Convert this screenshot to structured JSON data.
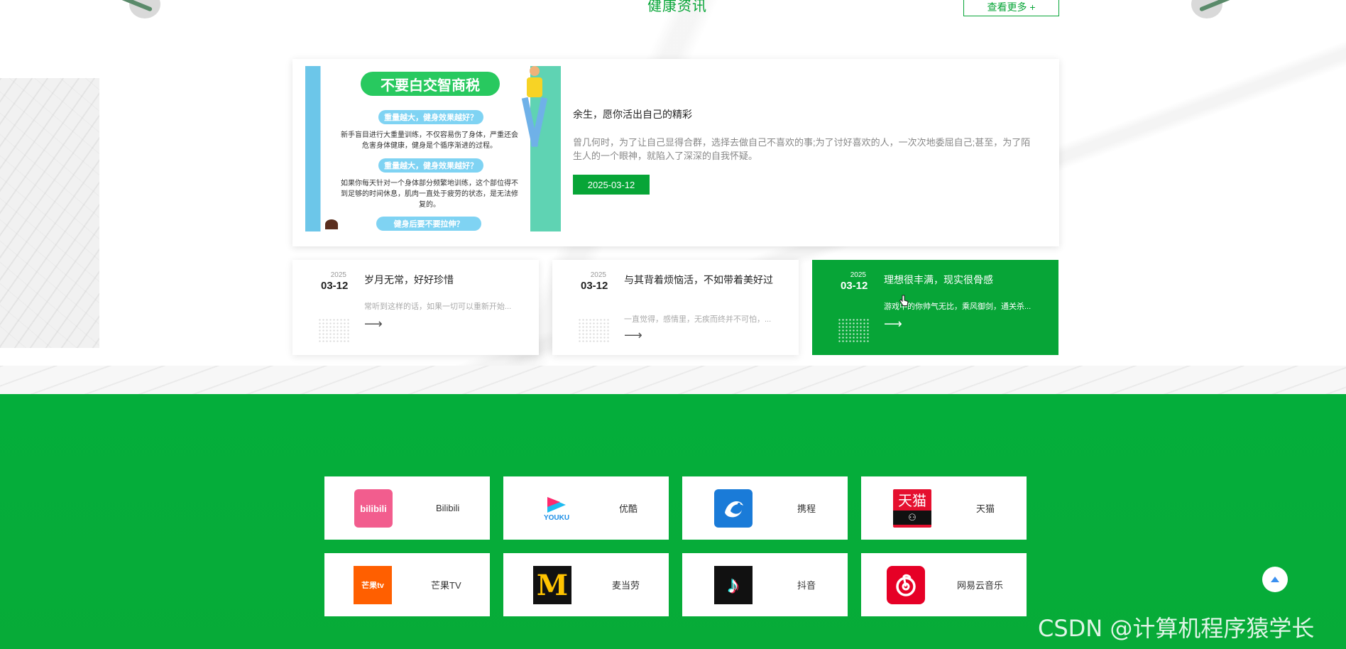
{
  "header": {
    "section_title": "健康资讯",
    "more_label": "查看更多 +"
  },
  "featured": {
    "poster": {
      "title": "不要白交智商税",
      "pill1": "重量越大，健身效果越好？",
      "text1": "新手盲目进行大重量训练，不仅容易伤了身体，严重还会危害身体健康，健身是个循序渐进的过程。",
      "pill2": "重量越大，健身效果越好？",
      "text2": "如果你每天针对一个身体部分频繁地训练，这个部位得不到足够的时间休息，肌肉一直处于疲劳的状态，是无法修复的。",
      "pill3": "健身后要不要拉伸？"
    },
    "title": "余生，愿你活出自己的精彩",
    "description": "曾几何时，为了让自己显得合群，选择去做自己不喜欢的事;为了讨好喜欢的人，一次次地委屈自己;甚至，为了陌生人的一个眼神，就陷入了深深的自我怀疑。",
    "date": "2025-03-12"
  },
  "news": [
    {
      "year": "2025",
      "md": "03-12",
      "title": "岁月无常，好好珍惜",
      "desc": "常听到这样的话，如果一切可以重新开始...",
      "arrow": "⟶"
    },
    {
      "year": "2025",
      "md": "03-12",
      "title": "与其背着烦恼活，不如带着美好过",
      "desc": "一直觉得，感情里，无疾而终并不可怕，...",
      "arrow": "⟶"
    },
    {
      "year": "2025",
      "md": "03-12",
      "title": "理想很丰满，现实很骨感",
      "desc": "游戏中的你帅气无比，乘风御剑，通关杀...",
      "arrow": "⟶"
    }
  ],
  "links": [
    {
      "label": "Bilibili",
      "logo_text": "bilibili",
      "icon": "bilibili-icon"
    },
    {
      "label": "优酷",
      "logo_text": "YOUKU",
      "icon": "youku-icon"
    },
    {
      "label": "携程",
      "logo_text": "",
      "icon": "ctrip-icon"
    },
    {
      "label": "天猫",
      "logo_text": "天猫",
      "icon": "tmall-icon"
    },
    {
      "label": "芒果TV",
      "logo_text": "芒果tv",
      "icon": "mangotv-icon"
    },
    {
      "label": "麦当劳",
      "logo_text": "M",
      "icon": "mcdonalds-icon"
    },
    {
      "label": "抖音",
      "logo_text": "♪",
      "icon": "douyin-icon"
    },
    {
      "label": "网易云音乐",
      "logo_text": "",
      "icon": "netease-music-icon"
    }
  ],
  "watermark": "CSDN @计算机程序猿学长",
  "colors": {
    "brand_green": "#07a537",
    "footer_green": "#04ae3b"
  }
}
